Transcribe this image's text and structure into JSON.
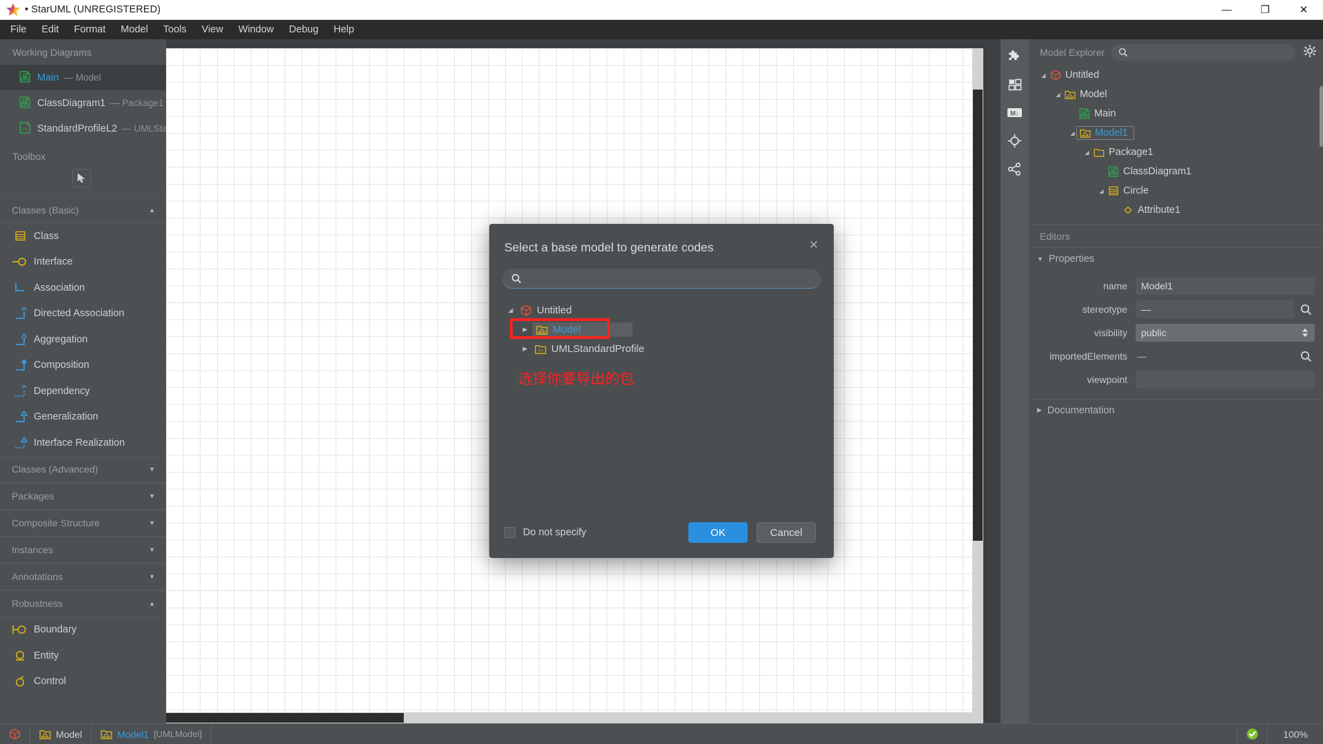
{
  "titlebar": {
    "app_title": "• StarUML (UNREGISTERED)",
    "minimize": "—",
    "maximize": "❐",
    "close": "✕",
    "app_icon": "star-icon"
  },
  "menubar": {
    "items": [
      {
        "label": "File"
      },
      {
        "label": "Edit"
      },
      {
        "label": "Format"
      },
      {
        "label": "Model"
      },
      {
        "label": "Tools"
      },
      {
        "label": "View"
      },
      {
        "label": "Window"
      },
      {
        "label": "Debug"
      },
      {
        "label": "Help"
      }
    ]
  },
  "left_panel": {
    "working_diagrams_title": "Working Diagrams",
    "diagrams": [
      {
        "name": "Main",
        "sub": "— Model",
        "icon": "class-diagram-icon",
        "selected": true
      },
      {
        "name": "ClassDiagram1",
        "sub": "— Package1",
        "icon": "class-diagram-icon",
        "selected": false
      },
      {
        "name": "StandardProfileL2",
        "sub": "— UMLSta",
        "icon": "profile-diagram-icon",
        "selected": false
      }
    ],
    "toolbox_title": "Toolbox",
    "groups": [
      {
        "label": "Classes (Basic)",
        "caret": "▲",
        "expanded": true,
        "items": [
          {
            "label": "Class",
            "icon": "class-icon"
          },
          {
            "label": "Interface",
            "icon": "interface-icon"
          },
          {
            "label": "Association",
            "icon": "association-icon"
          },
          {
            "label": "Directed Association",
            "icon": "directed-association-icon"
          },
          {
            "label": "Aggregation",
            "icon": "aggregation-icon"
          },
          {
            "label": "Composition",
            "icon": "composition-icon"
          },
          {
            "label": "Dependency",
            "icon": "dependency-icon"
          },
          {
            "label": "Generalization",
            "icon": "generalization-icon"
          },
          {
            "label": "Interface Realization",
            "icon": "interface-realization-icon"
          }
        ]
      },
      {
        "label": "Classes (Advanced)",
        "caret": "▼",
        "expanded": false,
        "items": []
      },
      {
        "label": "Packages",
        "caret": "▼",
        "expanded": false,
        "items": []
      },
      {
        "label": "Composite Structure",
        "caret": "▼",
        "expanded": false,
        "items": []
      },
      {
        "label": "Instances",
        "caret": "▼",
        "expanded": false,
        "items": []
      },
      {
        "label": "Annotations",
        "caret": "▼",
        "expanded": false,
        "items": []
      },
      {
        "label": "Robustness",
        "caret": "▲",
        "expanded": true,
        "items": [
          {
            "label": "Boundary",
            "icon": "boundary-icon"
          },
          {
            "label": "Entity",
            "icon": "entity-icon"
          },
          {
            "label": "Control",
            "icon": "control-icon"
          }
        ]
      }
    ]
  },
  "rail": {
    "buttons": [
      {
        "icon": "puzzle-extension-icon"
      },
      {
        "icon": "panels-layout-icon"
      },
      {
        "icon": "markdown-icon"
      },
      {
        "icon": "target-crosshair-icon"
      },
      {
        "icon": "share-icon"
      }
    ]
  },
  "model_explorer": {
    "title": "Model Explorer",
    "search_placeholder": "",
    "search_value": "",
    "search_icon": "search-icon",
    "settings_icon": "gear-icon",
    "tree": [
      {
        "label": "Untitled",
        "icon": "project-cube-icon",
        "depth": 0,
        "arrow": "◢",
        "selected": false
      },
      {
        "label": "Model",
        "icon": "model-icon",
        "depth": 1,
        "arrow": "◢",
        "selected": false
      },
      {
        "label": "Main",
        "icon": "class-diagram-icon",
        "depth": 2,
        "arrow": "",
        "selected": false
      },
      {
        "label": "Model1",
        "icon": "model-icon",
        "depth": 2,
        "arrow": "◢",
        "selected": true
      },
      {
        "label": "Package1",
        "icon": "package-icon",
        "depth": 3,
        "arrow": "◢",
        "selected": false
      },
      {
        "label": "ClassDiagram1",
        "icon": "class-diagram-icon",
        "depth": 4,
        "arrow": "",
        "selected": false
      },
      {
        "label": "Circle",
        "icon": "class-icon",
        "depth": 4,
        "arrow": "◢",
        "selected": false
      },
      {
        "label": "Attribute1",
        "icon": "attribute-icon",
        "depth": 5,
        "arrow": "",
        "selected": false
      }
    ]
  },
  "editors": {
    "title": "Editors",
    "properties_section": {
      "label": "Properties",
      "tri": "▼",
      "expanded": true
    },
    "documentation_section": {
      "label": "Documentation",
      "tri": "▶",
      "expanded": false
    },
    "properties": [
      {
        "label": "name",
        "value": "Model1",
        "type": "text"
      },
      {
        "label": "stereotype",
        "value": "—",
        "type": "text-search",
        "search_icon": "search-icon"
      },
      {
        "label": "visibility",
        "value": "public",
        "type": "combo",
        "stepper_icon": "stepper-updown-icon"
      },
      {
        "label": "importedElements",
        "value": "—",
        "type": "plain-search",
        "search_icon": "search-icon"
      },
      {
        "label": "viewpoint",
        "value": "",
        "type": "text"
      }
    ]
  },
  "dialog": {
    "title": "Select a base model to generate codes",
    "close_label": "✕",
    "search_placeholder": "",
    "search_value": "",
    "search_icon": "search-icon",
    "tree": [
      {
        "label": "Untitled",
        "icon": "project-cube-icon",
        "depth": 0,
        "arrow": "◢",
        "selected": false
      },
      {
        "label": "Model",
        "icon": "model-icon",
        "depth": 1,
        "arrow": "▶",
        "selected": true
      },
      {
        "label": "UMLStandardProfile",
        "icon": "profile-icon",
        "depth": 1,
        "arrow": "▶",
        "selected": false
      }
    ],
    "annotation": "选择你要导出的包",
    "annotation_color": "#fb2222",
    "highlight_color": "#fb2222",
    "checkbox_label": "Do not specify",
    "checkbox_checked": false,
    "ok_label": "OK",
    "cancel_label": "Cancel",
    "ok_color": "#2b8fe0"
  },
  "statusbar": {
    "left_items": [
      {
        "label": "",
        "icon": "project-cube-icon",
        "dim": "",
        "blue": false
      },
      {
        "label": "Model",
        "icon": "model-icon",
        "dim": "",
        "blue": false
      },
      {
        "label": "Model1",
        "icon": "model-icon",
        "dim": "[UMLModel]",
        "blue": true
      }
    ],
    "right": {
      "status_icon": "check-circle-icon",
      "status_color": "#7cbf2e",
      "zoom": "100%"
    }
  },
  "canvas": {
    "zoom_grid": "24.6px",
    "background": "#ffffff",
    "grid_color": "#e3e4e6"
  }
}
